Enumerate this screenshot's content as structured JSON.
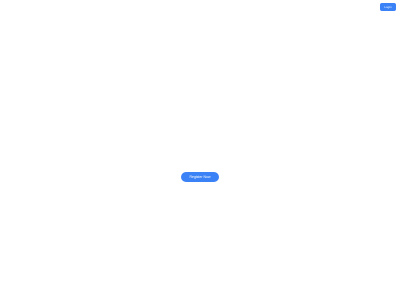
{
  "header": {
    "login_label": "Login"
  },
  "main": {
    "register_label": "Register Now"
  },
  "colors": {
    "accent": "#3b82f6",
    "background": "#ffffff"
  }
}
